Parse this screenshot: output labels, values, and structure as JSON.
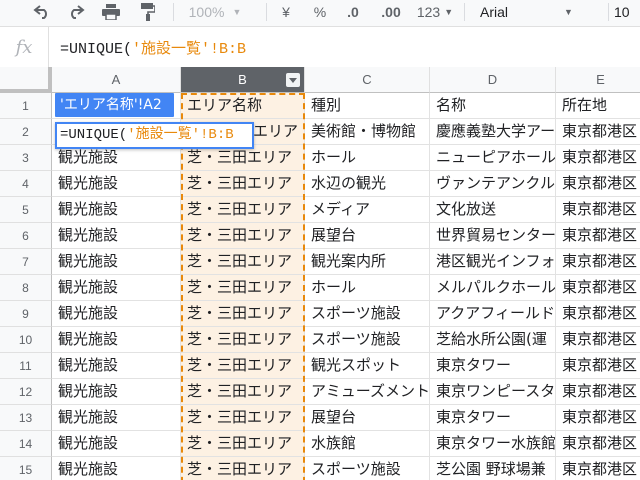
{
  "toolbar": {
    "undo_icon": "undo-icon",
    "redo_icon": "redo-icon",
    "print_icon": "print-icon",
    "paint_format_icon": "paint-format-icon",
    "zoom": "100%",
    "currency": "¥",
    "percent": "%",
    "decrease_decimal": ".0",
    "increase_decimal": ".00",
    "more_formats": "123",
    "font": "Arial",
    "font_size": "10"
  },
  "formula_bar": {
    "fx_label": "fx",
    "prefix": "=UNIQUE(",
    "ref": "'施設一覧'!B:B"
  },
  "columns": [
    "A",
    "B",
    "C",
    "D",
    "E"
  ],
  "rows": [
    {
      "n": "1",
      "a": "",
      "b": "エリア名称",
      "c": "種別",
      "d": "名称",
      "e": "所在地"
    },
    {
      "n": "2",
      "a": "",
      "b": "",
      "c": "美術館・博物館",
      "d": "慶應義塾大学アート",
      "e": "東京都港区"
    },
    {
      "n": "3",
      "a": "観光施設",
      "b": "芝・三田エリア",
      "c": "ホール",
      "d": "ニューピアホール",
      "e": "東京都港区"
    },
    {
      "n": "4",
      "a": "観光施設",
      "b": "芝・三田エリア",
      "c": "水辺の観光",
      "d": "ヴァンテアンクル",
      "e": "東京都港区"
    },
    {
      "n": "5",
      "a": "観光施設",
      "b": "芝・三田エリア",
      "c": "メディア",
      "d": "文化放送",
      "e": "東京都港区"
    },
    {
      "n": "6",
      "a": "観光施設",
      "b": "芝・三田エリア",
      "c": "展望台",
      "d": "世界貿易センター",
      "e": "東京都港区"
    },
    {
      "n": "7",
      "a": "観光施設",
      "b": "芝・三田エリア",
      "c": "観光案内所",
      "d": "港区観光インフォ",
      "e": "東京都港区"
    },
    {
      "n": "8",
      "a": "観光施設",
      "b": "芝・三田エリア",
      "c": "ホール",
      "d": "メルパルクホール",
      "e": "東京都港区"
    },
    {
      "n": "9",
      "a": "観光施設",
      "b": "芝・三田エリア",
      "c": "スポーツ施設",
      "d": "アクアフィールド",
      "e": "東京都港区"
    },
    {
      "n": "10",
      "a": "観光施設",
      "b": "芝・三田エリア",
      "c": "スポーツ施設",
      "d": "芝給水所公園(運",
      "e": "東京都港区"
    },
    {
      "n": "11",
      "a": "観光施設",
      "b": "芝・三田エリア",
      "c": "観光スポット",
      "d": "東京タワー",
      "e": "東京都港区"
    },
    {
      "n": "12",
      "a": "観光施設",
      "b": "芝・三田エリア",
      "c": "アミューズメント",
      "d": "東京ワンピースタ",
      "e": "東京都港区"
    },
    {
      "n": "13",
      "a": "観光施設",
      "b": "芝・三田エリア",
      "c": "展望台",
      "d": "東京タワー",
      "e": "東京都港区"
    },
    {
      "n": "14",
      "a": "観光施設",
      "b": "芝・三田エリア",
      "c": "水族館",
      "d": "東京タワー水族館",
      "e": "東京都港区"
    },
    {
      "n": "15",
      "a": "観光施設",
      "b": "芝・三田エリア",
      "c": "スポーツ施設",
      "d": "芝公園 野球場兼",
      "e": "東京都港区"
    }
  ],
  "b2_tail": "エリア",
  "tooltip": "'エリア名称'!A2",
  "editor": {
    "prefix": "=UNIQUE(",
    "ref": "'施設一覧'!B:B"
  },
  "colors": {
    "reference": "#e8890c",
    "selection_fill": "#fdf1e3",
    "tooltip_bg": "#4285f4"
  }
}
